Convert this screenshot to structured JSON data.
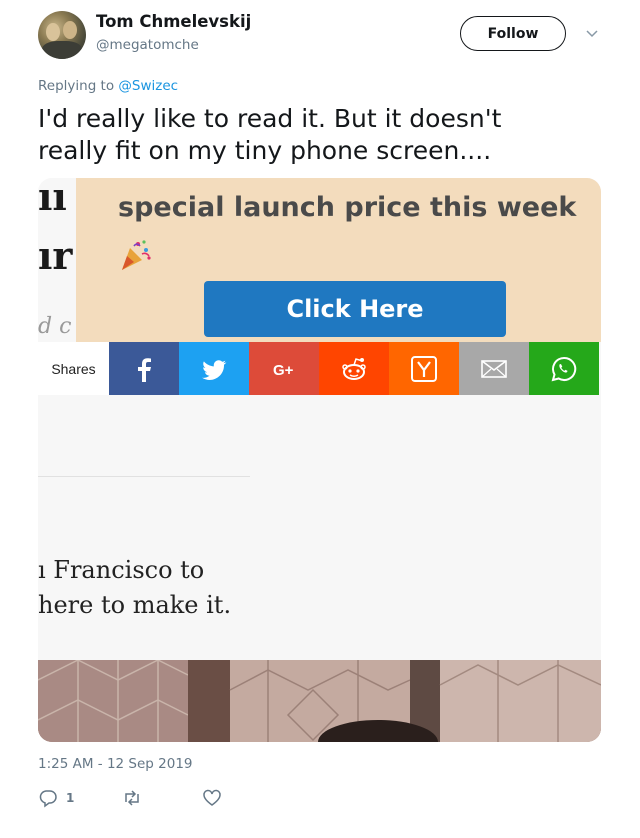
{
  "author": {
    "name": "Tom Chmelevskij",
    "handle": "@megatomche"
  },
  "follow_label": "Follow",
  "reply_prefix": "Replying to ",
  "reply_mention": "@Swizec",
  "tweet": {
    "text_line1": "I'd really like to read it. But it doesn't",
    "text_line2": "really fit on my tiny phone screen...."
  },
  "media": {
    "fragment_1": "ıı",
    "fragment_2": "ır",
    "fragment_3": "d c",
    "promo_text": "special launch price this week",
    "promo_icon": "party-popper-icon",
    "cta_label": "Click Here",
    "share_label": "Shares",
    "share_buttons": [
      {
        "name": "facebook",
        "color": "#3b5998"
      },
      {
        "name": "twitter",
        "color": "#1da1f2"
      },
      {
        "name": "google-plus",
        "color": "#dd4b39"
      },
      {
        "name": "reddit",
        "color": "#ff4500"
      },
      {
        "name": "hacker-news",
        "color": "#ff6600"
      },
      {
        "name": "email",
        "color": "#a8a8a8"
      },
      {
        "name": "whatsapp",
        "color": "#25a81a"
      }
    ],
    "article_line1": "ı Francisco to",
    "article_line2": "here to make it."
  },
  "timestamp": "1:25 AM - 12 Sep 2019",
  "actions": {
    "reply_count": "1"
  },
  "colors": {
    "link": "#1b95e0",
    "muted": "#657786",
    "promo_bg": "#f3dcbd",
    "cta_bg": "#1f78c1"
  }
}
